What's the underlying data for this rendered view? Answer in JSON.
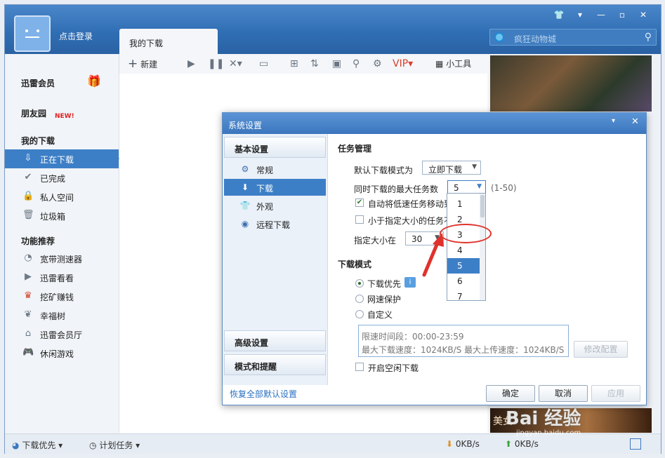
{
  "header": {
    "login": "点击登录",
    "tab": "我的下载",
    "search_placeholder": "疯狂动物城"
  },
  "sidebar": {
    "vip": "迅雷会员",
    "friends": "朋友园",
    "new_badge": "NEW!",
    "my_downloads": "我的下载",
    "downloads": [
      {
        "label": "正在下载",
        "icon": "download-icon"
      },
      {
        "label": "已完成",
        "icon": "check-icon"
      },
      {
        "label": "私人空间",
        "icon": "lock-icon"
      },
      {
        "label": "垃圾箱",
        "icon": "trash-icon"
      }
    ],
    "features_head": "功能推荐",
    "features": [
      {
        "label": "宽带测速器",
        "icon": "speedometer-icon"
      },
      {
        "label": "迅雷看看",
        "icon": "play-icon"
      },
      {
        "label": "挖矿赚钱",
        "icon": "crown-icon"
      },
      {
        "label": "幸福树",
        "icon": "leaf-icon"
      },
      {
        "label": "迅雷会员厅",
        "icon": "house-icon"
      },
      {
        "label": "休闲游戏",
        "icon": "gamepad-icon"
      }
    ]
  },
  "toolbar": {
    "new": "新建",
    "tools": "小工具"
  },
  "statusbar": {
    "priority": "下载优先",
    "schedule": "计划任务",
    "down_speed": "0KB/s",
    "up_speed": "0KB/s"
  },
  "right_ad": {
    "caption": "美女"
  },
  "dialog": {
    "title": "系统设置",
    "basic_settings": "基本设置",
    "nav": [
      {
        "label": "常规",
        "icon": "gear-icon"
      },
      {
        "label": "下载",
        "icon": "download-icon"
      },
      {
        "label": "外观",
        "icon": "shirt-icon"
      },
      {
        "label": "远程下载",
        "icon": "remote-icon"
      }
    ],
    "advanced_settings": "高级设置",
    "mode_and_alerts": "模式和提醒",
    "restore_defaults": "恢复全部默认设置",
    "task_mgmt": "任务管理",
    "default_mode_label": "默认下载模式为",
    "default_mode_value": "立即下载",
    "max_tasks_label": "同时下载的最大任务数",
    "max_tasks_value": "5",
    "max_tasks_range": "(1-50)",
    "auto_move_label": "自动将低速任务移动到",
    "auto_move_checked": true,
    "smaller_than_label": "小于指定大小的任务不",
    "size_label": "指定大小在",
    "size_value": "30",
    "download_mode": "下载模式",
    "mode_options": [
      {
        "label": "下载优先",
        "selected": true
      },
      {
        "label": "网速保护",
        "selected": false
      },
      {
        "label": "自定义",
        "selected": false
      }
    ],
    "limit_period": "限速时间段：00:00-23:59",
    "limit_speeds": "最大下载速度：1024KB/S  最大上传速度：1024KB/S",
    "modify_config": "修改配置",
    "idle_download": "开启空闲下载",
    "ok": "确定",
    "cancel": "取消",
    "apply": "应用",
    "dropdown_options": [
      "1",
      "2",
      "3",
      "4",
      "5",
      "6",
      "7"
    ],
    "dropdown_selected": "5"
  },
  "watermark": {
    "logo": "Bai 经验",
    "url": "jingyan.baidu.com"
  }
}
